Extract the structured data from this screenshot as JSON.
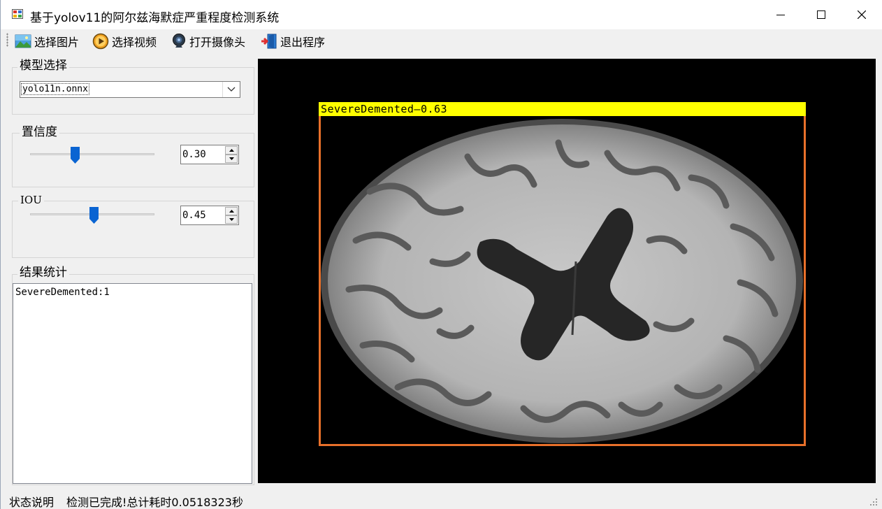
{
  "window": {
    "title": "基于yolov11的阿尔兹海默症严重程度检测系统",
    "minimize_glyph": "—",
    "maximize_glyph": "☐",
    "close_glyph": "✕"
  },
  "toolbar": {
    "items": [
      {
        "label": "选择图片",
        "icon": "picture-icon"
      },
      {
        "label": "选择视频",
        "icon": "video-play-icon"
      },
      {
        "label": "打开摄像头",
        "icon": "webcam-icon"
      },
      {
        "label": "退出程序",
        "icon": "exit-door-icon"
      }
    ]
  },
  "model_group": {
    "label": "模型选择",
    "selected": "yolo11n.onnx"
  },
  "confidence_group": {
    "label": "置信度",
    "value": "0.30",
    "slider_fraction": 0.3
  },
  "iou_group": {
    "label": "IOU",
    "value": "0.45",
    "slider_fraction": 0.45
  },
  "results_group": {
    "label": "结果统计",
    "text": "SevereDemented:1"
  },
  "detection": {
    "label": "SevereDemented—0.63",
    "box_color": "#e8702a",
    "label_bg": "#ffff00"
  },
  "status": {
    "label": "状态说明",
    "message": "检测已完成!总计耗时0.0518323秒"
  },
  "colors": {
    "slider_thumb": "#0a64d2",
    "viewer_bg": "#000000"
  }
}
